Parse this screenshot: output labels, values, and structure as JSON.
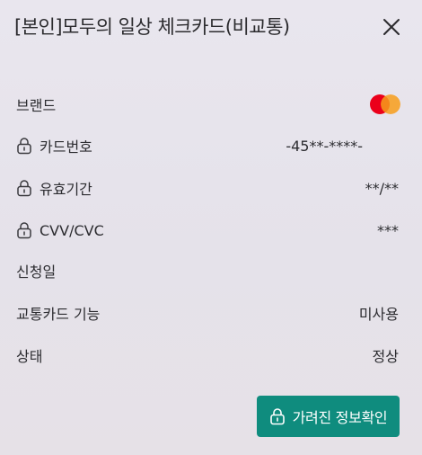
{
  "header": {
    "title": "[본인]모두의 일상 체크카드(비교통)",
    "close_icon": "close-icon"
  },
  "rows": [
    {
      "label": "브랜드",
      "value": "",
      "locked": false,
      "brand": "mastercard"
    },
    {
      "label": "카드번호",
      "value": "-45**-****-",
      "locked": true
    },
    {
      "label": "유효기간",
      "value": "**/**",
      "locked": true
    },
    {
      "label": "CVV/CVC",
      "value": "***",
      "locked": true
    },
    {
      "label": "신청일",
      "value": "",
      "locked": false
    },
    {
      "label": "교통카드 기능",
      "value": "미사용",
      "locked": false
    },
    {
      "label": "상태",
      "value": "정상",
      "locked": false
    }
  ],
  "reveal_button": {
    "label": "가려진 정보확인",
    "icon": "lock-icon"
  },
  "colors": {
    "background": "#e6e3ea",
    "accent": "#0f8c7e",
    "text": "#2c2c30",
    "mastercard_red": "#eb001b",
    "mastercard_orange": "#f79e1b"
  }
}
